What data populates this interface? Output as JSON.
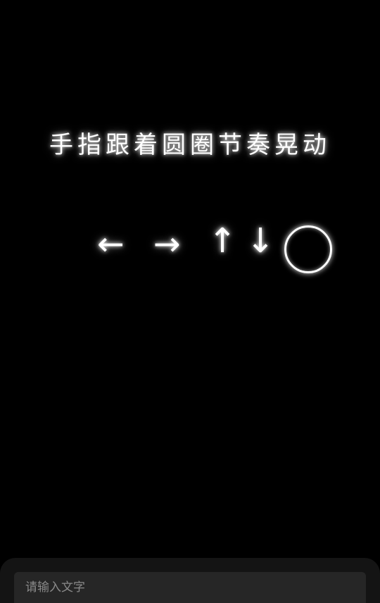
{
  "title": "手指跟着圆圈节奏晃动",
  "glyphs": {
    "left_arrow": "←",
    "right_arrow": "→",
    "up_arrow": "↑",
    "down_arrow": "↓"
  },
  "input": {
    "placeholder": "请输入文字",
    "value": ""
  },
  "colors": {
    "background": "#000000",
    "glow": "#ffffff",
    "bar": "#141414",
    "input_bg": "#262626"
  }
}
